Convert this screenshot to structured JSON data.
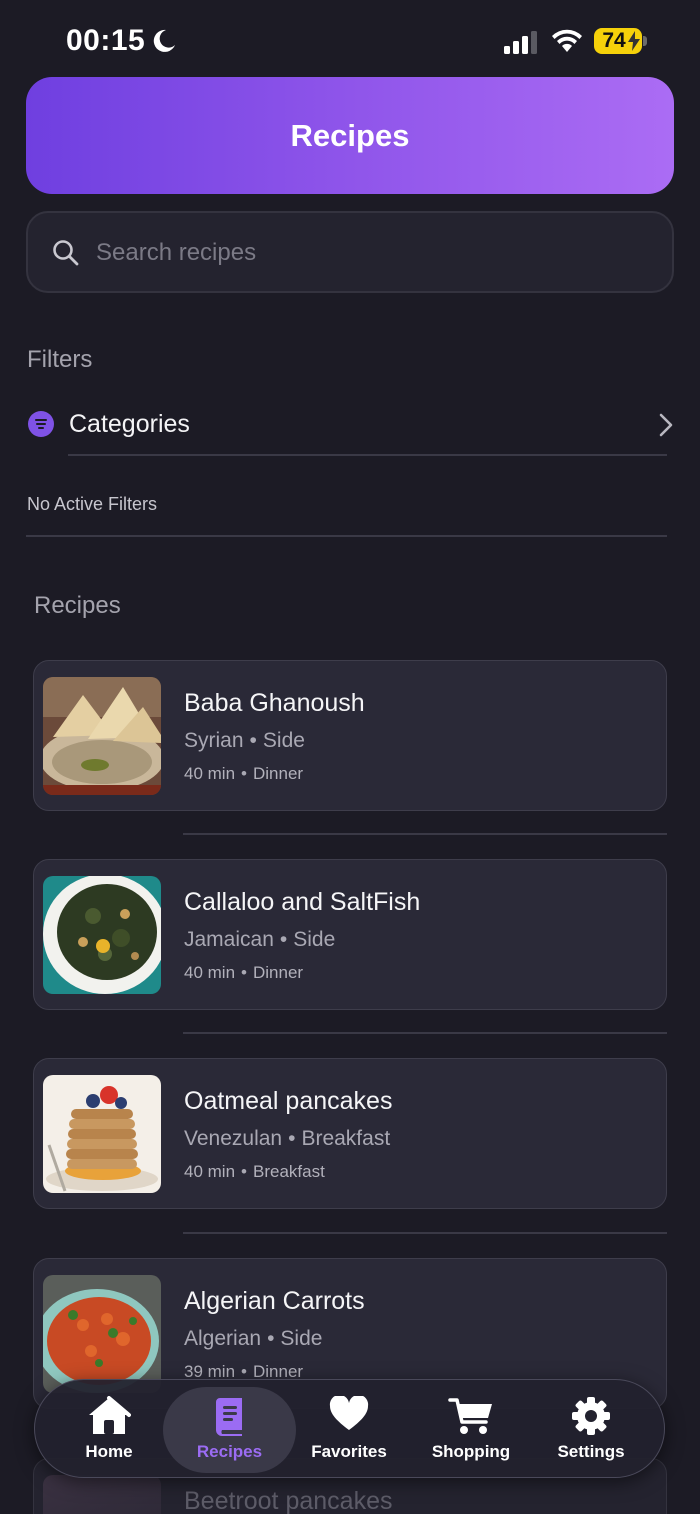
{
  "status_bar": {
    "time": "00:15",
    "battery": "74"
  },
  "header": {
    "title": "Recipes"
  },
  "search": {
    "placeholder": "Search recipes"
  },
  "filters": {
    "section_label": "Filters",
    "categories_label": "Categories",
    "active_filters_text": "No Active Filters"
  },
  "recipes": {
    "section_label": "Recipes",
    "items": [
      {
        "title": "Baba Ghanoush",
        "cuisine": "Syrian",
        "category": "Side",
        "time": "40 min",
        "meal": "Dinner"
      },
      {
        "title": "Callaloo and SaltFish",
        "cuisine": "Jamaican",
        "category": "Side",
        "time": "40 min",
        "meal": "Dinner"
      },
      {
        "title": "Oatmeal pancakes",
        "cuisine": "Venezulan",
        "category": "Breakfast",
        "time": "40 min",
        "meal": "Breakfast"
      },
      {
        "title": "Algerian Carrots",
        "cuisine": "Algerian",
        "category": "Side",
        "time": "39 min",
        "meal": "Dinner"
      },
      {
        "title": "Beetroot pancakes"
      }
    ]
  },
  "tab_bar": {
    "tabs": [
      {
        "label": "Home",
        "icon": "house-icon"
      },
      {
        "label": "Recipes",
        "icon": "book-icon",
        "active": true
      },
      {
        "label": "Favorites",
        "icon": "heart-icon"
      },
      {
        "label": "Shopping",
        "icon": "cart-icon"
      },
      {
        "label": "Settings",
        "icon": "gear-icon"
      }
    ]
  },
  "colors": {
    "accent": "#9b6cf3",
    "header_gradient_start": "#6f3fe0",
    "header_gradient_end": "#ab6cf4",
    "background": "#1c1b25"
  }
}
